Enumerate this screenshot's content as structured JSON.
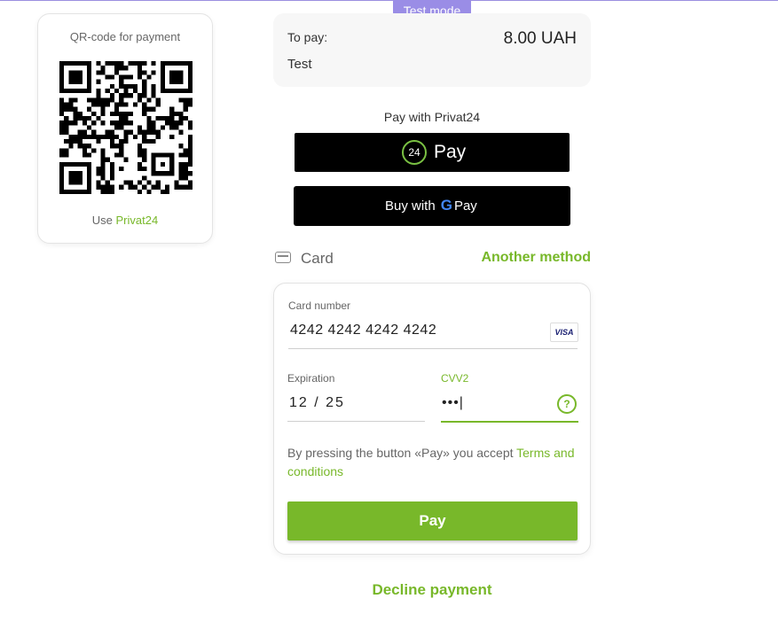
{
  "badge": "Test mode",
  "qr": {
    "title": "QR-code for payment",
    "use_prefix": "Use",
    "use_link": "Privat24"
  },
  "summary": {
    "to_pay_label": "To pay:",
    "amount": "8.00 UAH",
    "description": "Test"
  },
  "privat24": {
    "title": "Pay with Privat24",
    "logo_number": "24",
    "button_label": "Pay"
  },
  "gpay": {
    "prefix": "Buy with",
    "g": "G",
    "pay": "Pay"
  },
  "card_section": {
    "label": "Card",
    "another_method": "Another method"
  },
  "form": {
    "card_number_label": "Card number",
    "card_number_value": "4242 4242 4242 4242",
    "card_brand": "VISA",
    "expiration_label": "Expiration",
    "expiration_value": "12 / 25",
    "cvv_label": "CVV2",
    "cvv_value": "•••|",
    "help_glyph": "?",
    "terms_text": "By pressing the button «Pay» you accept ",
    "terms_link": "Terms and conditions",
    "pay_button": "Pay"
  },
  "decline": "Decline payment",
  "colors": {
    "accent": "#78b82a",
    "badge": "#9a8de6"
  }
}
